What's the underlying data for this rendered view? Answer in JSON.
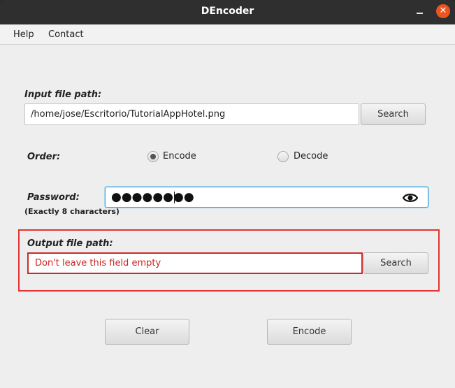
{
  "window": {
    "title": "DEncoder"
  },
  "menu": {
    "items": [
      "Help",
      "Contact"
    ]
  },
  "input": {
    "label": "Input file path:",
    "value": "/home/jose/Escritorio/TutorialAppHotel.png",
    "search_label": "Search"
  },
  "order": {
    "label": "Order:",
    "options": [
      "Encode",
      "Decode"
    ],
    "selected": "Encode"
  },
  "password": {
    "label": "Password:",
    "hint": "(Exactly 8 characters)",
    "masked_value": "●●●●●●●●"
  },
  "output": {
    "label": "Output file path:",
    "placeholder": "Don't leave this field empty",
    "search_label": "Search",
    "error_color": "#e53333"
  },
  "actions": {
    "clear_label": "Clear",
    "encode_label": "Encode"
  }
}
